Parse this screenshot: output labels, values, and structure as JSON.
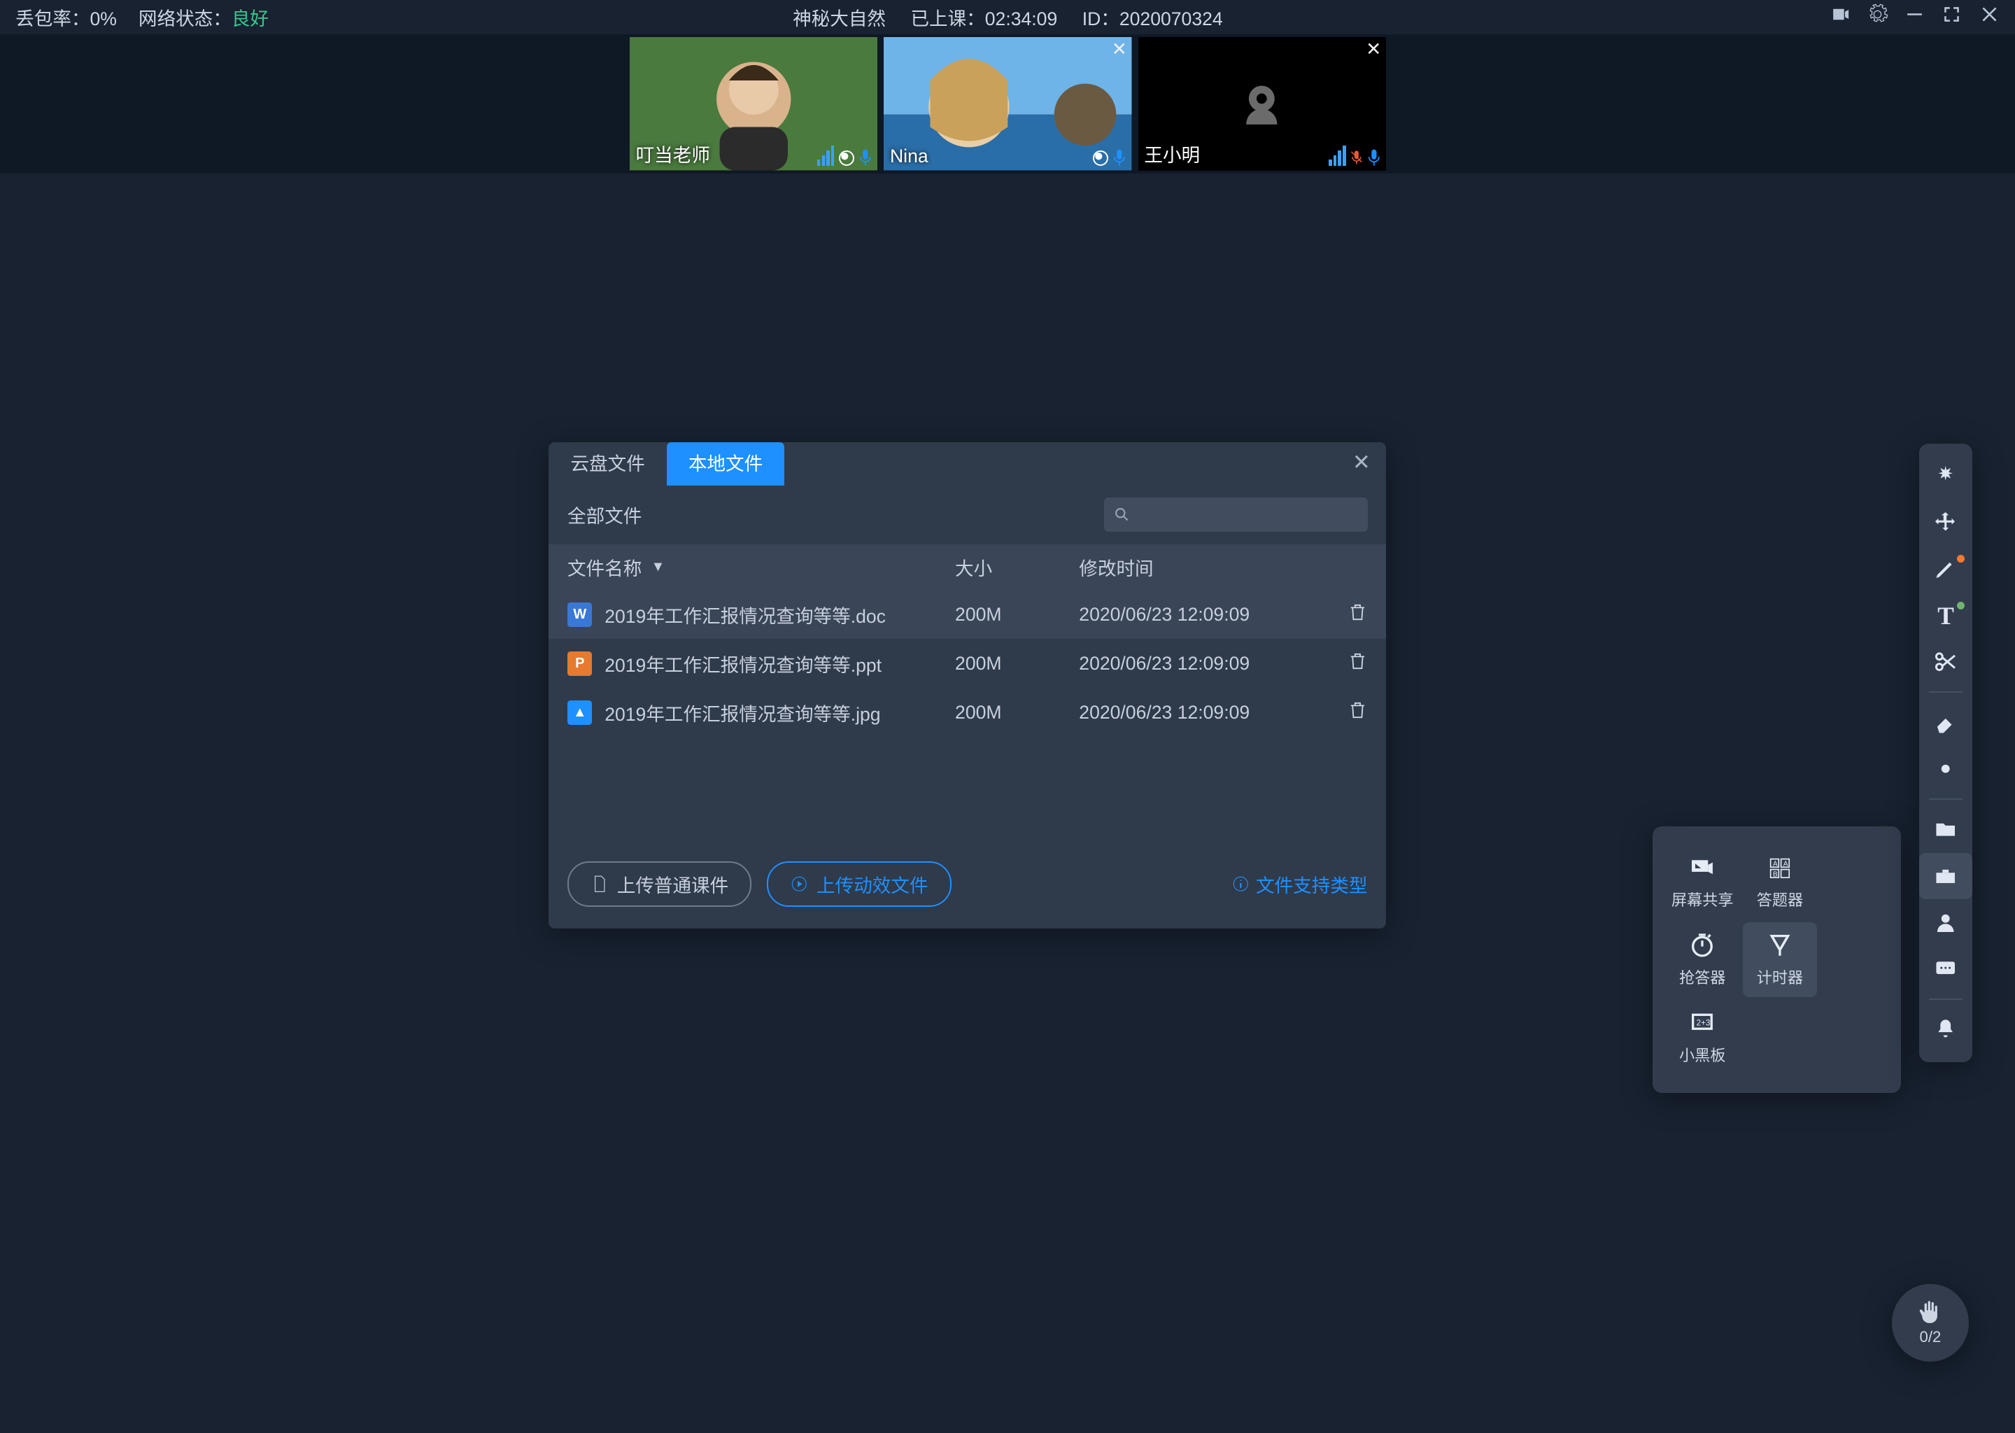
{
  "topbar": {
    "loss_label": "丢包率：",
    "loss_value": "0%",
    "net_label": "网络状态：",
    "net_value": "良好",
    "title": "神秘大自然",
    "elapsed_label": "已上课：",
    "elapsed": "02:34:09",
    "id_label": "ID：",
    "id": "2020070324"
  },
  "videos": [
    {
      "name": "叮当老师",
      "camera_on": true,
      "closable": false,
      "mic_muted": false
    },
    {
      "name": "Nina",
      "camera_on": true,
      "closable": true,
      "mic_muted": false
    },
    {
      "name": "王小明",
      "camera_on": false,
      "closable": true,
      "mic_muted": true
    }
  ],
  "dialog": {
    "tabs": {
      "cloud": "云盘文件",
      "local": "本地文件"
    },
    "all_files": "全部文件",
    "headers": {
      "name": "文件名称",
      "size": "大小",
      "mtime": "修改时间"
    },
    "rows": [
      {
        "icon": "W",
        "iconClass": "ic-doc",
        "name": "2019年工作汇报情况查询等等.doc",
        "size": "200M",
        "mtime": "2020/06/23 12:09:09"
      },
      {
        "icon": "P",
        "iconClass": "ic-ppt",
        "name": "2019年工作汇报情况查询等等.ppt",
        "size": "200M",
        "mtime": "2020/06/23 12:09:09"
      },
      {
        "icon": "▲",
        "iconClass": "ic-jpg",
        "name": "2019年工作汇报情况查询等等.jpg",
        "size": "200M",
        "mtime": "2020/06/23 12:09:09"
      }
    ],
    "upload_normal": "上传普通课件",
    "upload_anim": "上传动效文件",
    "support_link": "文件支持类型"
  },
  "tools_pop": {
    "items": [
      {
        "label": "屏幕共享"
      },
      {
        "label": "答题器"
      },
      {
        "label": "抢答器"
      },
      {
        "label": "计时器",
        "active": true
      },
      {
        "label": "小黑板"
      }
    ]
  },
  "raise_hand": {
    "count": "0/2"
  }
}
